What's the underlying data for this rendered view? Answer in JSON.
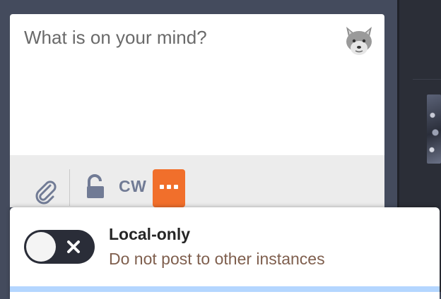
{
  "compose": {
    "placeholder": "What is on your mind?",
    "emoji_icon": "fox-emoji-icon"
  },
  "toolbar": {
    "attach_icon": "paperclip-icon",
    "privacy_icon": "unlock-icon",
    "cw_label": "CW",
    "more_icon": "ellipsis-icon",
    "more_color": "#f16f2b"
  },
  "dropdown": {
    "option_title": "Local-only",
    "option_description": "Do not post to other instances",
    "toggle_state": "off"
  }
}
